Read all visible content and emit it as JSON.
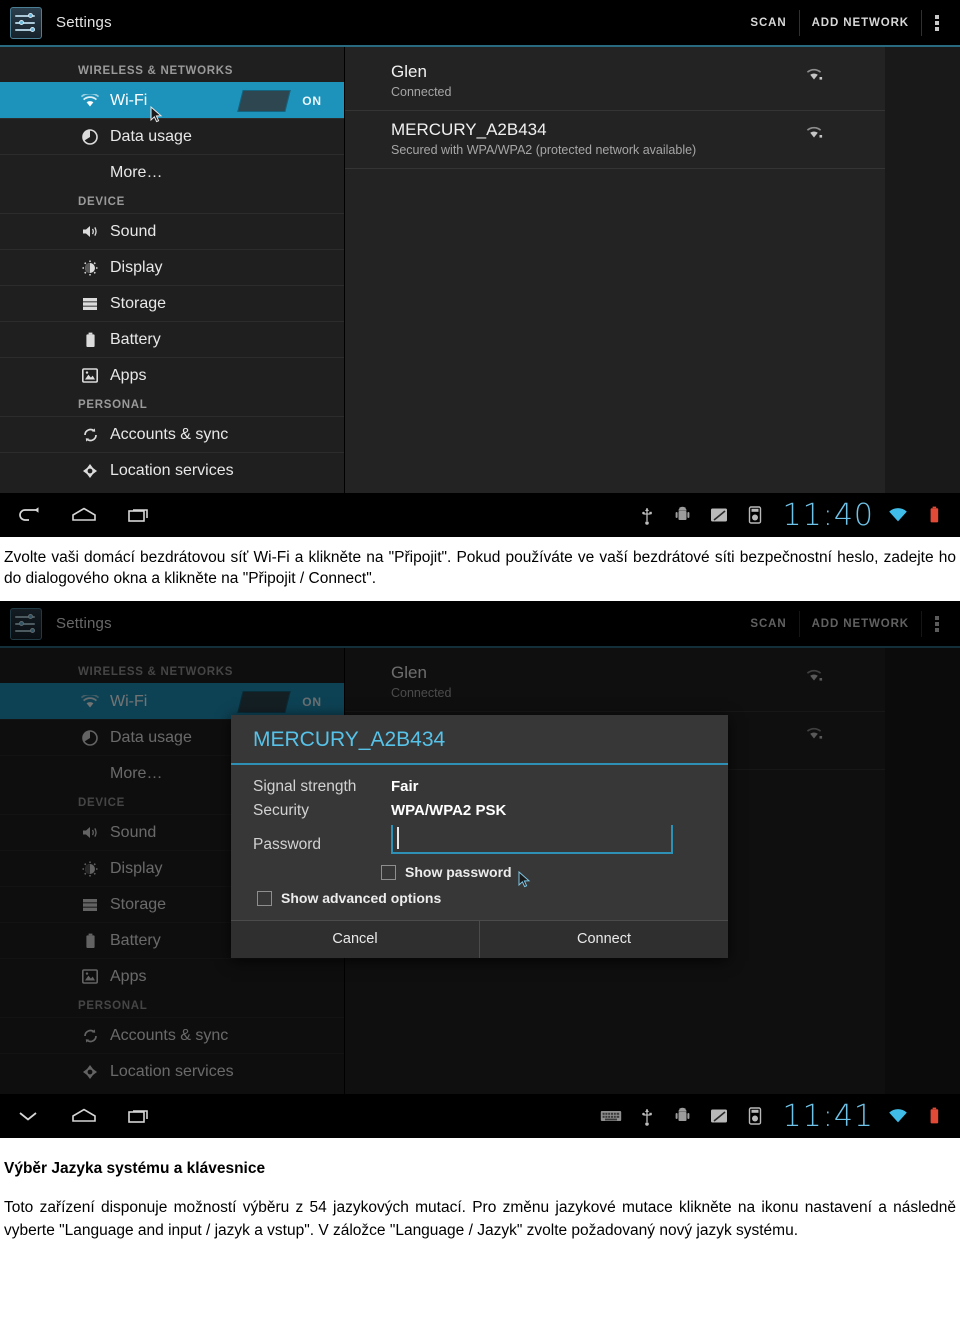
{
  "screens": [
    {
      "id": "wifi-list",
      "action_bar": {
        "app_title": "Settings",
        "scan_label": "SCAN",
        "add_network_label": "ADD NETWORK"
      },
      "sidebar": {
        "groups": [
          {
            "header": "WIRELESS & NETWORKS",
            "items": [
              {
                "label": "Wi-Fi",
                "icon": "wifi-icon",
                "selected": true,
                "toggle": "ON"
              },
              {
                "label": "Data usage",
                "icon": "data-usage-icon",
                "selected": false
              },
              {
                "label": "More…",
                "icon": "",
                "selected": false
              }
            ]
          },
          {
            "header": "DEVICE",
            "items": [
              {
                "label": "Sound",
                "icon": "sound-icon",
                "selected": false
              },
              {
                "label": "Display",
                "icon": "display-icon",
                "selected": false
              },
              {
                "label": "Storage",
                "icon": "storage-icon",
                "selected": false
              },
              {
                "label": "Battery",
                "icon": "battery-icon",
                "selected": false
              },
              {
                "label": "Apps",
                "icon": "apps-icon",
                "selected": false
              }
            ]
          },
          {
            "header": "PERSONAL",
            "items": [
              {
                "label": "Accounts & sync",
                "icon": "sync-icon",
                "selected": false
              },
              {
                "label": "Location services",
                "icon": "location-icon",
                "selected": false
              }
            ]
          }
        ]
      },
      "networks": [
        {
          "name": "Glen",
          "status": "Connected"
        },
        {
          "name": "MERCURY_A2B434",
          "status": "Secured with WPA/WPA2 (protected network available)"
        }
      ],
      "system_bar": {
        "back_icon": "back-arrow-icon",
        "home_icon": "home-icon",
        "recents_icon": "recent-apps-icon",
        "clock": "11:40",
        "status_icons": [
          "usb-icon",
          "android-debug-icon",
          "sd-card-icon",
          "settings-chip-icon",
          "wifi-signal-icon",
          "battery-icon"
        ]
      }
    },
    {
      "id": "wifi-password-dialog",
      "action_bar": {
        "app_title": "Settings",
        "scan_label": "SCAN",
        "add_network_label": "ADD NETWORK"
      },
      "dialog": {
        "title": "MERCURY_A2B434",
        "rows": [
          {
            "key": "Signal strength",
            "value": "Fair"
          },
          {
            "key": "Security",
            "value": "WPA/WPA2 PSK"
          }
        ],
        "password_label": "Password",
        "password_value": "",
        "show_password_label": "Show password",
        "show_advanced_label": "Show advanced options",
        "cancel_label": "Cancel",
        "connect_label": "Connect"
      },
      "system_bar": {
        "back_icon": "chevron-down-icon",
        "home_icon": "home-icon",
        "recents_icon": "recent-apps-icon",
        "clock": "11:41",
        "status_icons": [
          "keyboard-icon",
          "usb-icon",
          "android-debug-icon",
          "sd-card-icon",
          "settings-chip-icon",
          "wifi-signal-icon",
          "battery-icon"
        ]
      }
    }
  ],
  "caption_1": "Zvolte vaši domácí bezdrátovou síť Wi-Fi a klikněte na \"Připojit\". Pokud používáte ve vaší bezdrátové síti bezpečnostní heslo, zadejte ho do dialogového okna a klikněte na \"Připojit / Connect\".",
  "section_title": "Výběr Jazyka systému a klávesnice",
  "body_text": "Toto zařízení disponuje možností výběru z 54 jazykových mutací. Pro změnu jazykové mutace klikněte na ikonu nastavení a následně vyberte \"Language and input / jazyk a vstup\". V záložce \"Language / Jazyk\" zvolte požadovaný nový jazyk systému.",
  "colors": {
    "accent_blue": "#1d92ba",
    "dialog_accent": "#57c2e8",
    "clock_blue": "#6fc3e8",
    "panel_bg": "#232323",
    "sidebar_bg": "#1f1f1f"
  }
}
